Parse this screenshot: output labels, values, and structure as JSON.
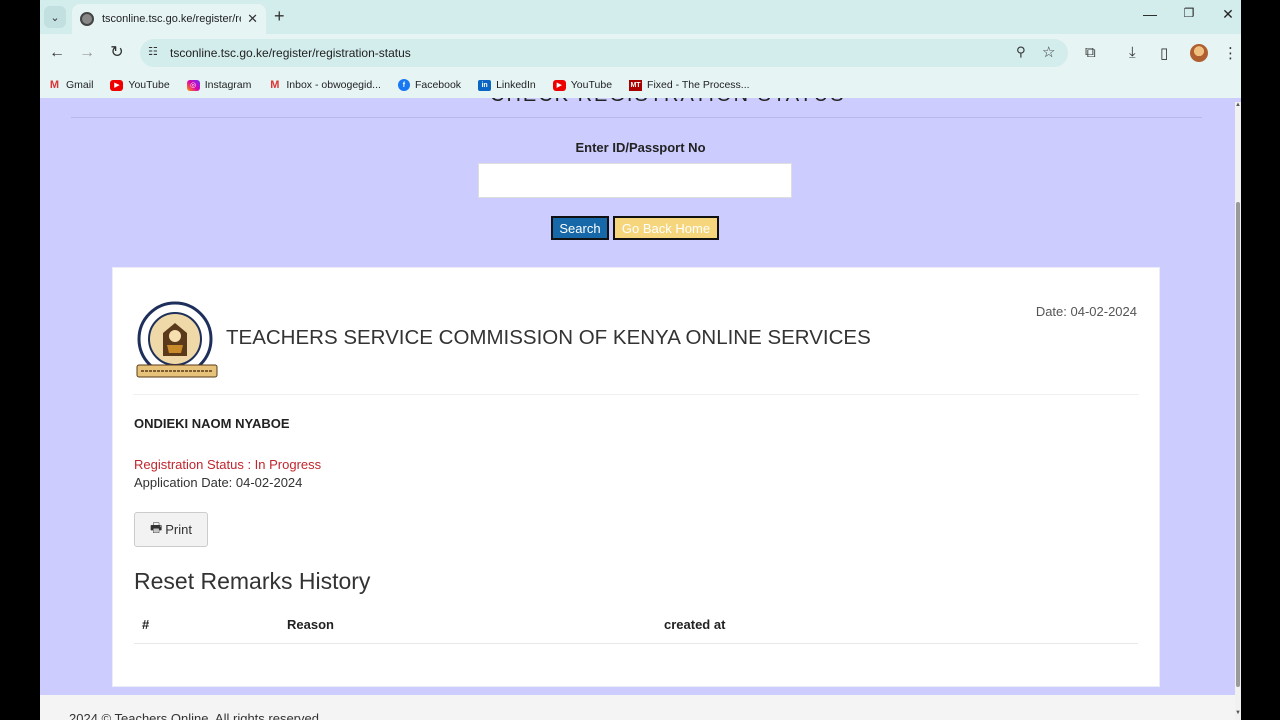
{
  "browser": {
    "tab": {
      "title": "tsconline.tsc.go.ke/register/regi"
    },
    "url": "tsconline.tsc.go.ke/register/registration-status",
    "bookmarks": [
      {
        "label": "Gmail",
        "icon": "gmail-icon"
      },
      {
        "label": "YouTube",
        "icon": "youtube-icon"
      },
      {
        "label": "Instagram",
        "icon": "instagram-icon"
      },
      {
        "label": "Inbox - obwogegid...",
        "icon": "gmail-icon"
      },
      {
        "label": "Facebook",
        "icon": "facebook-icon"
      },
      {
        "label": "LinkedIn",
        "icon": "linkedin-icon"
      },
      {
        "label": "YouTube",
        "icon": "youtube-icon"
      },
      {
        "label": "Fixed - The Process...",
        "icon": "mt-icon"
      }
    ]
  },
  "page": {
    "cut_title": "CHECK REGISTRATION STATUS",
    "id_label": "Enter ID/Passport No",
    "id_value": "",
    "search_label": "Search",
    "home_label": "Go Back Home",
    "card": {
      "date": "Date: 04-02-2024",
      "org_name": "TEACHERS SERVICE COMMISSION OF KENYA ONLINE SERVICES",
      "logo_text": {
        "top": "TEACHERS SERVICE COMMISSION",
        "bottom": "KENYA",
        "motto": "EFFECTIVE TEACHERS FOR QUALITY EDUCATION"
      },
      "applicant": "ONDIEKI NAOM NYABOE",
      "status": "Registration Status : In Progress",
      "application_date": "Application Date: 04-02-2024",
      "print_label": "Print",
      "remarks_title": "Reset Remarks History",
      "table_headers": [
        "#",
        "Reason",
        "created at"
      ]
    },
    "footer": "2024 © Teachers Online. All rights reserved."
  },
  "colors": {
    "page_bg": "#ccccff",
    "search_button": "#1668a8",
    "home_button": "#f5d67d",
    "status_text": "#c0262d"
  }
}
